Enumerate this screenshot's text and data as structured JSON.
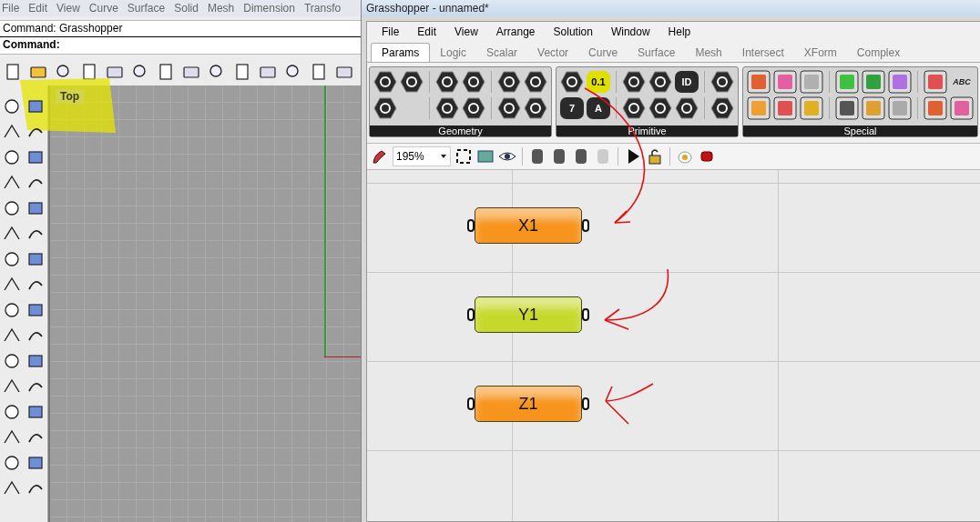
{
  "rhino": {
    "menu": [
      "File",
      "Edit",
      "View",
      "Curve",
      "Surface",
      "Solid",
      "Mesh",
      "Dimension",
      "Transfo"
    ],
    "command_history": "Command: Grasshopper",
    "command_prompt": "Command:",
    "viewport": {
      "label": "Top"
    }
  },
  "grasshopper": {
    "title": "Grasshopper - unnamed*",
    "menu": [
      "File",
      "Edit",
      "View",
      "Arrange",
      "Solution",
      "Window",
      "Help"
    ],
    "tabs": [
      {
        "label": "Params",
        "selected": true
      },
      {
        "label": "Logic",
        "selected": false
      },
      {
        "label": "Scalar",
        "selected": false
      },
      {
        "label": "Vector",
        "selected": false
      },
      {
        "label": "Curve",
        "selected": false
      },
      {
        "label": "Surface",
        "selected": false
      },
      {
        "label": "Mesh",
        "selected": false
      },
      {
        "label": "Intersect",
        "selected": false
      },
      {
        "label": "XForm",
        "selected": false
      },
      {
        "label": "Complex",
        "selected": false
      }
    ],
    "panels": [
      {
        "title": "Geometry",
        "kind": "hex"
      },
      {
        "title": "Primitive",
        "kind": "hex",
        "glyphs": [
          "0.1",
          "ID",
          "7",
          "A"
        ]
      },
      {
        "title": "Special",
        "kind": "square",
        "glyphs": [
          "ABC"
        ]
      }
    ],
    "zoom": "195%",
    "nodes": [
      {
        "label": "X1",
        "color": "#f7941d"
      },
      {
        "label": "Y1",
        "color": "#c5d92d"
      },
      {
        "label": "Z1",
        "color": "#f7941d"
      }
    ]
  }
}
